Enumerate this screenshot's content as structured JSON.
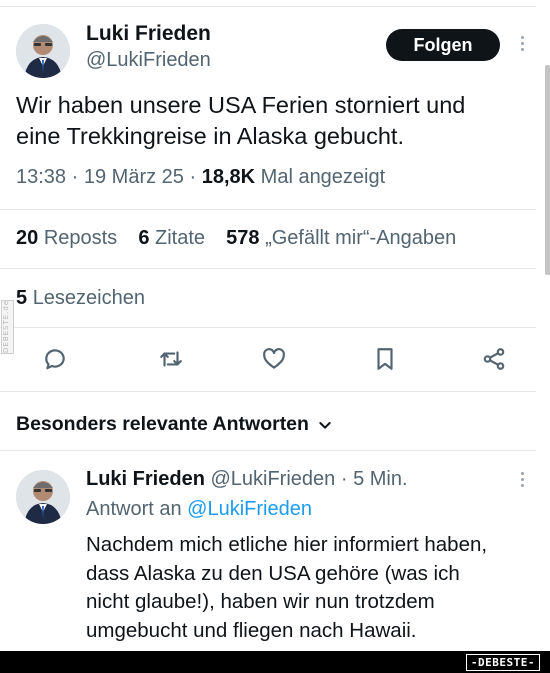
{
  "tweet": {
    "author_name": "Luki Frieden",
    "author_handle": "@LukiFrieden",
    "follow_label": "Folgen",
    "text_line1": "Wir haben unsere USA Ferien storniert und",
    "text_line2": "eine Trekkingreise in Alaska gebucht.",
    "time": "13:38",
    "sep1": "·",
    "date": "19 März 25",
    "sep2": "·",
    "views": "18,8K",
    "views_label": "Mal angezeigt"
  },
  "stats": {
    "reposts_count": "20",
    "reposts_label": "Reposts",
    "quotes_count": "6",
    "quotes_label": "Zitate",
    "likes_count": "578",
    "likes_label": "„Gefällt mir“-Angaben",
    "bookmarks_count": "5",
    "bookmarks_label": "Lesezeichen"
  },
  "actions": {
    "icons": [
      "reply-icon",
      "repost-icon",
      "like-icon",
      "bookmark-icon",
      "share-icon"
    ]
  },
  "replies": {
    "sort_label": "Besonders relevante Antworten",
    "sort_icon": "chevron-down-icon",
    "items": [
      {
        "author_name": "Luki Frieden",
        "author_handle": "@LukiFrieden",
        "sep": "·",
        "age": "5 Min.",
        "reply_to_label": "Antwort an",
        "reply_to_handle": "@LukiFrieden",
        "text_line1": "Nachdem mich etliche hier informiert haben,",
        "text_line2": "dass Alaska zu den USA gehöre (was ich",
        "text_line3": "nicht glaube!), haben wir nun trotzdem",
        "text_line4": "umgebucht und fliegen nach Hawaii."
      }
    ]
  },
  "watermark": {
    "side_text": "DEBESTE.de",
    "logo_text": "-DEBESTE-"
  },
  "colors": {
    "text": "#0f1419",
    "muted": "#536471",
    "link": "#1d9bf0",
    "follow_bg": "#0f1419",
    "divider": "#e6e9ec"
  }
}
